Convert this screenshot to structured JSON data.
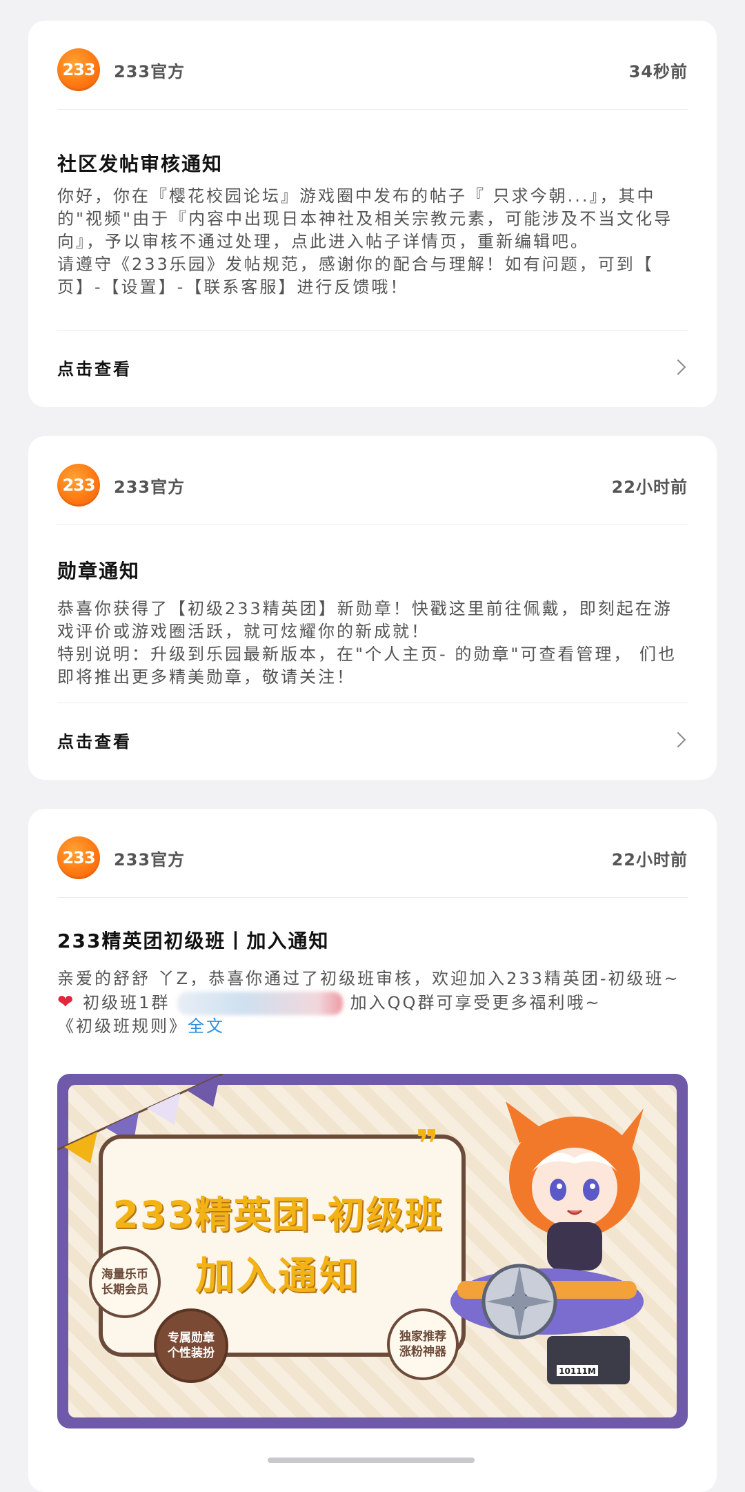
{
  "cards": [
    {
      "sender": "233官方",
      "avatar_text": "233",
      "time": "34秒前",
      "title": "社区发帖审核通知",
      "body": [
        "你好，你在『樱花校园论坛』游戏圈中发布的帖子『 只求今朝...』，其中的\"视频\"由于『内容中出现日本神社及相关宗教元素，可能涉及不当文化导向』，予以审核不通过处理，点此进入帖子详情页，重新编辑吧。",
        "请遵守《233乐园》发帖规范，感谢你的配合与理解！如有问题，可到【 页】-【设置】-【联系客服】进行反馈哦！"
      ],
      "action": "点击查看"
    },
    {
      "sender": "233官方",
      "avatar_text": "233",
      "time": "22小时前",
      "title": "勋章通知",
      "body": [
        "恭喜你获得了【初级233精英团】新勋章！快戳这里前往佩戴，即刻起在游戏评价或游戏圈活跃，就可炫耀你的新成就！",
        "特别说明：升级到乐园最新版本，在\"个人主页- 的勋章\"可查看管理， 们也即将推出更多精美勋章，敬请关注！"
      ],
      "action": "点击查看"
    },
    {
      "sender": "233官方",
      "avatar_text": "233",
      "time": "22小时前",
      "title": "233精英团初级班丨加入通知",
      "body_line1": "亲爱的舒舒 丫Z，恭喜你通过了初级班审核，欢迎加入233精英团-初级班~",
      "body_line2_prefix": "初级班1群",
      "body_line2_suffix": "加入QQ群可享受更多福利哦~",
      "body_line3_prefix": "《初级班规则》",
      "body_line3_link": "全文",
      "banner": {
        "title_line1": "233精英团-初级班",
        "title_line2": "加入通知",
        "quote_mark": "❞",
        "badge1": "海量乐币\n长期会员",
        "badge2": "专属勋章\n个性装扮",
        "badge3": "独家推荐\n涨粉神器",
        "sign_text": "10111M"
      }
    }
  ]
}
